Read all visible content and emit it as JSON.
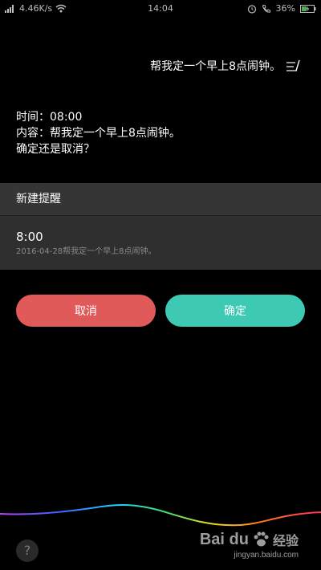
{
  "status_bar": {
    "network_speed": "4.46K/s",
    "time": "14:04",
    "battery_percent": "36%"
  },
  "query": {
    "text": "帮我定一个早上8点闹钟。",
    "edit_icon": "edit-pen-icon"
  },
  "reply": {
    "line1": "时间：08:00",
    "line2": "内容：帮我定一个早上8点闹钟。",
    "line3": "确定还是取消？"
  },
  "card": {
    "header": "新建提醒",
    "time": "8:00",
    "description": "2016-04-28帮我定一个早上8点闹钟。"
  },
  "buttons": {
    "cancel_label": "取消",
    "confirm_label": "确定",
    "cancel_color": "#e05a5a",
    "confirm_color": "#3ec9b4"
  },
  "help": {
    "label": "?"
  },
  "watermark": {
    "brand": "Bai du",
    "brand_cn": "经验",
    "url": "jingyan.baidu.com"
  }
}
